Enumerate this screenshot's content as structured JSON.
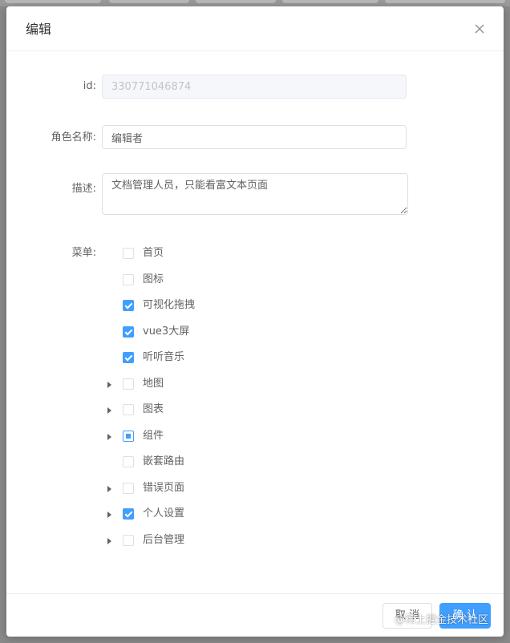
{
  "dialog": {
    "title": "编辑",
    "close_icon": "close-icon"
  },
  "form": {
    "id_label": "id:",
    "id_value": "330771046874",
    "role_label": "角色名称:",
    "role_value": "编辑者",
    "desc_label": "描述:",
    "desc_value": "文档管理人员，只能看富文本页面",
    "menu_label": "菜单:"
  },
  "tree": {
    "nodes": [
      {
        "label": "首页",
        "state": "unchecked",
        "expandable": false
      },
      {
        "label": "图标",
        "state": "unchecked",
        "expandable": false
      },
      {
        "label": "可视化拖拽",
        "state": "checked",
        "expandable": false
      },
      {
        "label": "vue3大屏",
        "state": "checked",
        "expandable": false
      },
      {
        "label": "听听音乐",
        "state": "checked",
        "expandable": false
      },
      {
        "label": "地图",
        "state": "unchecked",
        "expandable": true
      },
      {
        "label": "图表",
        "state": "unchecked",
        "expandable": true
      },
      {
        "label": "组件",
        "state": "indeterminate",
        "expandable": true
      },
      {
        "label": "嵌套路由",
        "state": "unchecked",
        "expandable": false
      },
      {
        "label": "错误页面",
        "state": "unchecked",
        "expandable": true
      },
      {
        "label": "个人设置",
        "state": "checked",
        "expandable": true
      },
      {
        "label": "后台管理",
        "state": "unchecked",
        "expandable": true
      }
    ]
  },
  "footer": {
    "cancel_label": "取 消",
    "confirm_label": "确 认"
  },
  "watermark": "@稀土掘金技术社区",
  "colors": {
    "primary": "#409eff",
    "text": "#606266",
    "overlay": "#8a8a8a"
  }
}
